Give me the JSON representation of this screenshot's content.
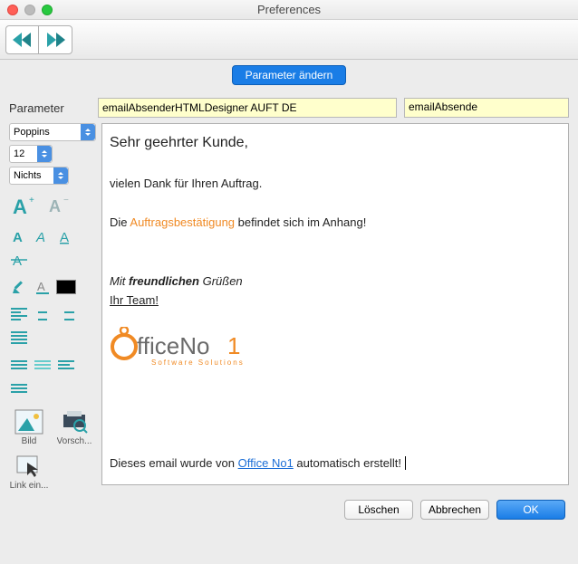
{
  "window": {
    "title": "Preferences"
  },
  "banner": {
    "label": "Parameter ändern"
  },
  "param": {
    "label": "Parameter",
    "value1": "emailAbsenderHTMLDesigner AUFT DE",
    "value2": "emailAbsende"
  },
  "sidebar": {
    "font_select": "Poppins",
    "size_select": "12",
    "style_select": "Nichts",
    "tools": {
      "bild": "Bild",
      "vorschau": "Vorsch...",
      "link": "Link ein..."
    }
  },
  "editor": {
    "greeting": "Sehr geehrter Kunde,",
    "l1": "vielen Dank für Ihren Auftrag.",
    "l2a": "Die ",
    "l2b": "Auftragsbestätigung",
    "l2c": " befindet sich im Anhang!",
    "l3a": "Mit ",
    "l3b": "freundlichen",
    "l3c": " Grüßen",
    "l4": "Ihr Team!",
    "logo_main": "fficeNo",
    "logo_sub": "Software  Solutions",
    "footer_a": "Dieses email wurde von ",
    "footer_link": "Office No1",
    "footer_b": " automatisch erstellt!"
  },
  "buttons": {
    "delete": "Löschen",
    "cancel": "Abbrechen",
    "ok": "OK"
  }
}
